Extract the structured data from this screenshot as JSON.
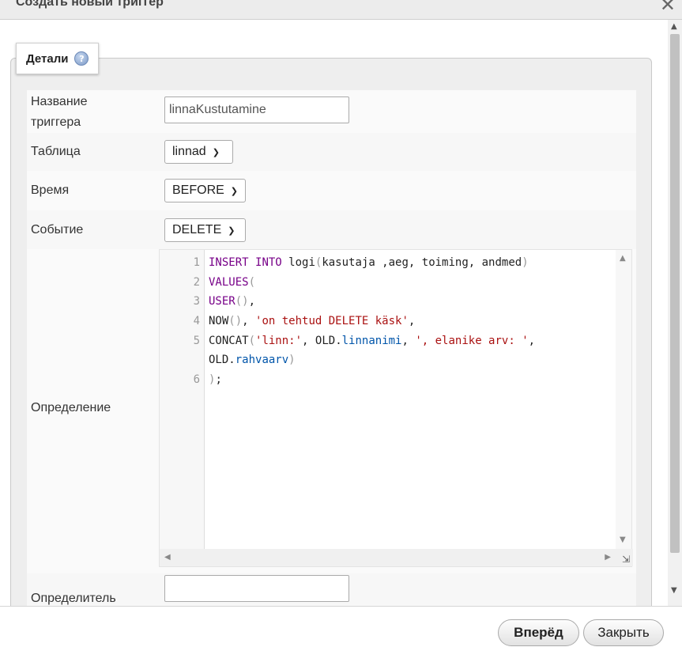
{
  "window": {
    "title": "Создать новый триггер",
    "close_glyph": "✕"
  },
  "fieldset": {
    "legend": "Детали",
    "help_icon": "help-icon"
  },
  "form": {
    "name_label_line1": "Название",
    "name_label_line2": "триггера",
    "name_value": "linnaKustutamine",
    "table_label": "Таблица",
    "table_value": "linnad",
    "time_label": "Время",
    "time_value": "BEFORE",
    "event_label": "Событие",
    "event_value": "DELETE",
    "definition_label": "Определение",
    "definer_label": "Определитель",
    "definer_value": ""
  },
  "editor": {
    "line_numbers": [
      "1",
      "2",
      "3",
      "4",
      "5",
      "6"
    ],
    "code": {
      "l1": {
        "kw1": "INSERT",
        "kw2": "INTO",
        "rest": " logi",
        "p1": "(",
        "args": "kasutaja ,aeg, toiming, andmed",
        "p2": ")"
      },
      "l2": {
        "fn": "VALUES",
        "p": "("
      },
      "l3": {
        "fn": "USER",
        "p": "()",
        "rest": ","
      },
      "l4": {
        "a": "NOW",
        "p": "()",
        "b": ", ",
        "str": "'on tehtud DELETE käsk'",
        "c": ","
      },
      "l5": {
        "a": "CONCAT",
        "p1": "(",
        "s1": "'linn:'",
        "b": ", OLD",
        "d": ".",
        "prop": "linnanimi",
        "c": ", ",
        "s2": "', elanike arv: '",
        "e": ","
      },
      "l5b": {
        "a": "OLD",
        "d": ".",
        "prop": "rahvaarv",
        "p": ")"
      },
      "l6": {
        "p": ")",
        "rest": ";"
      }
    }
  },
  "buttons": {
    "next": "Вперёд",
    "close": "Закрыть"
  }
}
